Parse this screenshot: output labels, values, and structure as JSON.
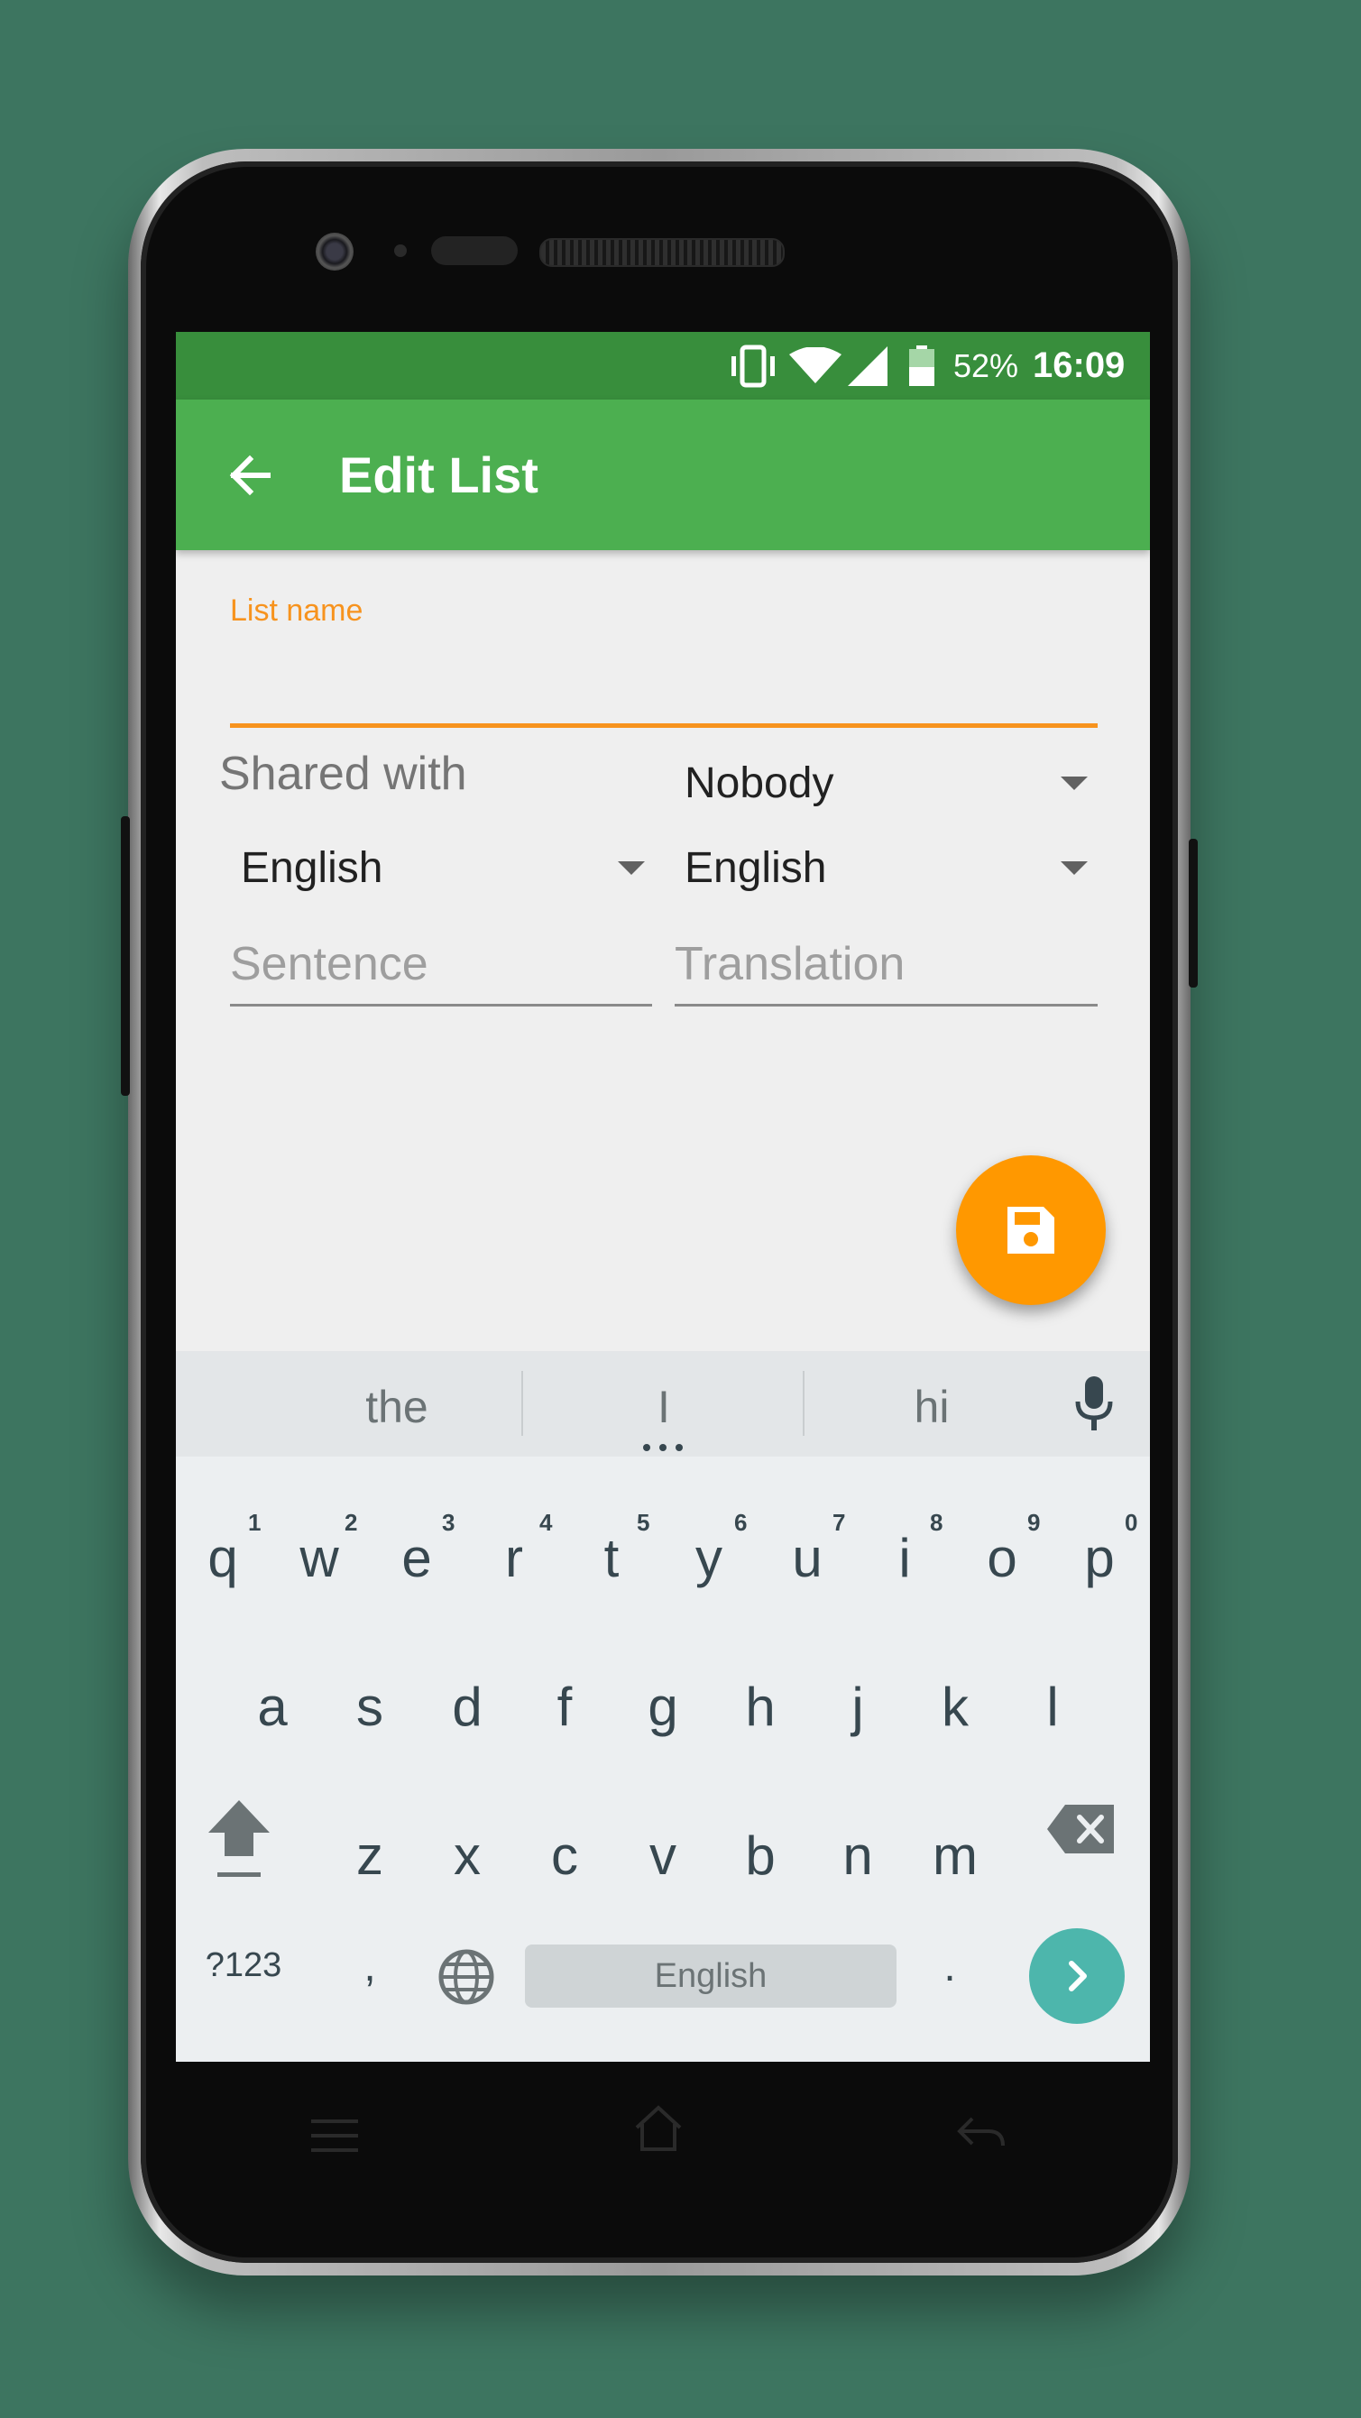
{
  "status_bar": {
    "battery_percent": "52%",
    "time": "16:09"
  },
  "app_bar": {
    "title": "Edit List"
  },
  "form": {
    "list_name_label": "List name",
    "list_name_value": "",
    "shared_with_label": "Shared with",
    "shared_with_value": "Nobody",
    "source_language": "English",
    "target_language": "English",
    "sentence_placeholder": "Sentence",
    "translation_placeholder": "Translation"
  },
  "fab": {
    "icon": "save-icon"
  },
  "keyboard": {
    "suggestions": [
      "the",
      "I",
      "hi"
    ],
    "row1": [
      "q",
      "w",
      "e",
      "r",
      "t",
      "y",
      "u",
      "i",
      "o",
      "p"
    ],
    "row1_hints": [
      "1",
      "2",
      "3",
      "4",
      "5",
      "6",
      "7",
      "8",
      "9",
      "0"
    ],
    "row2": [
      "a",
      "s",
      "d",
      "f",
      "g",
      "h",
      "j",
      "k",
      "l"
    ],
    "row3": [
      "z",
      "x",
      "c",
      "v",
      "b",
      "n",
      "m"
    ],
    "symbols_key": "?123",
    "comma_key": ",",
    "space_label": "English",
    "period_key": "."
  },
  "colors": {
    "accent": "#f7931e",
    "primary": "#4caf50",
    "primary_dark": "#388e3c",
    "fab": "#ff9800",
    "enter_key": "#4db6ac"
  }
}
